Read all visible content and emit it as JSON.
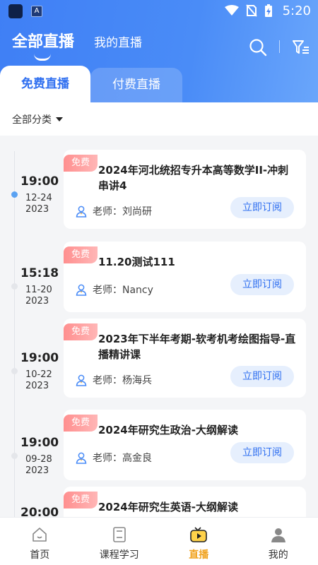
{
  "status_bar": {
    "time": "5:20",
    "app_badge": "A"
  },
  "header": {
    "tabs": {
      "all_live": "全部直播",
      "my_live": "我的直播"
    },
    "segments": {
      "free": "免费直播",
      "paid": "付费直播"
    }
  },
  "filter": {
    "category": "全部分类"
  },
  "lives": [
    {
      "time": "19:00",
      "month_day": "12-24",
      "year": "2023",
      "badge": "免费",
      "title": "2024年河北统招专升本高等数学II-冲刺串讲4",
      "teacher": "老师：刘尚研",
      "action": "立即订阅",
      "active": true
    },
    {
      "time": "15:18",
      "month_day": "11-20",
      "year": "2023",
      "badge": "免费",
      "title": "11.20测试111",
      "teacher": "老师：Nancy",
      "action": "立即订阅",
      "active": false
    },
    {
      "time": "19:00",
      "month_day": "10-22",
      "year": "2023",
      "badge": "免费",
      "title": "2023年下半年考期-软考机考绘图指导-直播精讲课",
      "teacher": "老师：杨海兵",
      "action": "立即订阅",
      "active": false
    },
    {
      "time": "19:00",
      "month_day": "09-28",
      "year": "2023",
      "badge": "免费",
      "title": "2024年研究生政治-大纲解读",
      "teacher": "老师：高金良",
      "action": "立即订阅",
      "active": false
    },
    {
      "time": "20:00",
      "month_day": "",
      "year": "",
      "badge": "免费",
      "title": "2024年研究生英语-大纲解读",
      "teacher": "",
      "action": "",
      "active": false
    }
  ],
  "bottom_nav": {
    "home": "首页",
    "courses": "课程学习",
    "live": "直播",
    "mine": "我的"
  },
  "colors": {
    "primary": "#3f7ff5",
    "accent_active_nav": "#f0a21e",
    "badge": "#ff8f8f"
  }
}
